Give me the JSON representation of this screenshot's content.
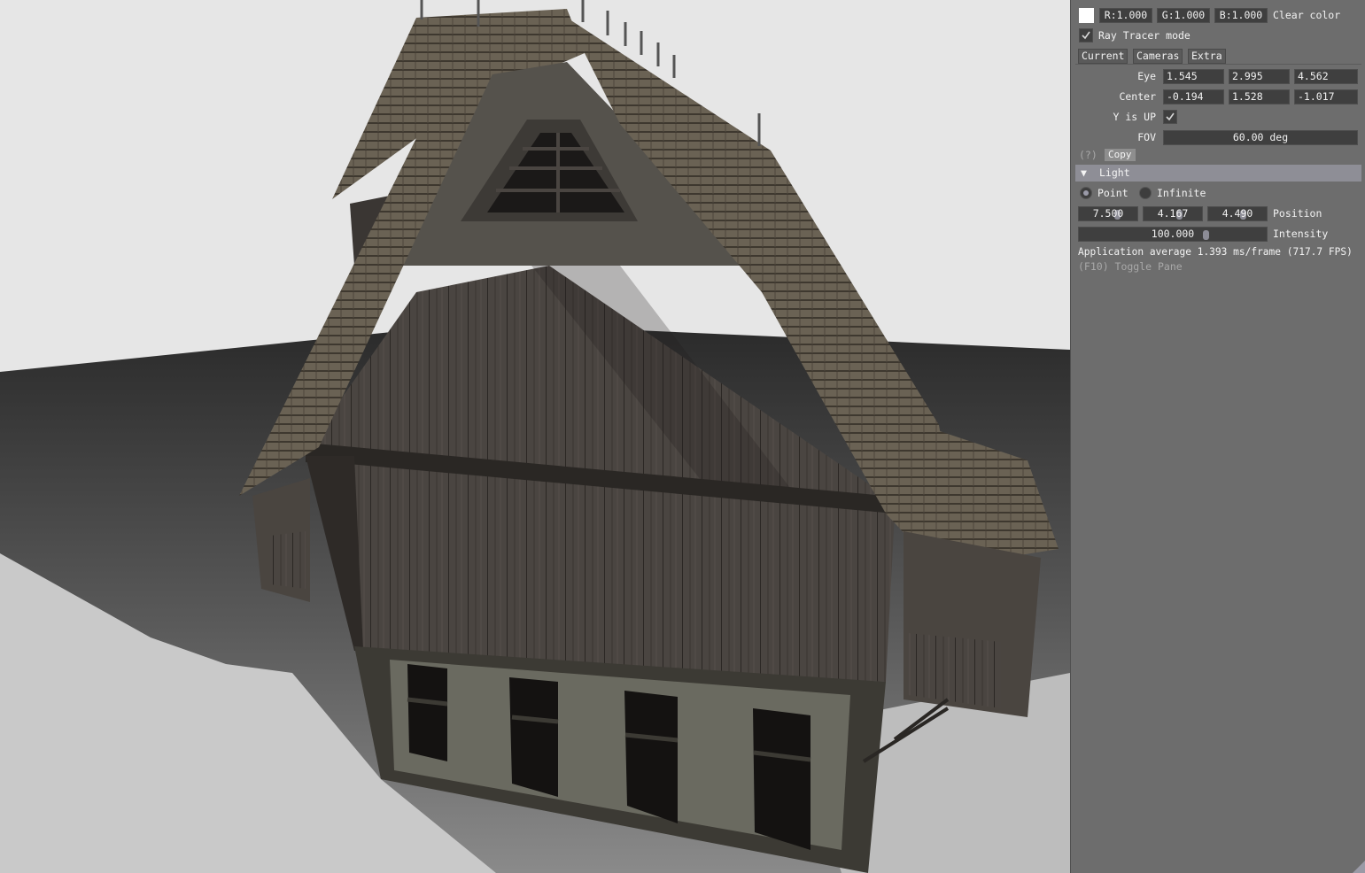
{
  "clear_color": {
    "swatch": "#ffffff",
    "r": "R:1.000",
    "g": "G:1.000",
    "b": "B:1.000",
    "label": "Clear color"
  },
  "ray_tracer": {
    "label": "Ray Tracer mode",
    "checked": true
  },
  "tabs": [
    {
      "label": "Current"
    },
    {
      "label": "Cameras"
    },
    {
      "label": "Extra"
    }
  ],
  "camera": {
    "eye": {
      "label": "Eye",
      "values": [
        "1.545",
        "2.995",
        "4.562"
      ]
    },
    "center": {
      "label": "Center",
      "values": [
        "-0.194",
        "1.528",
        "-1.017"
      ]
    },
    "y_up": {
      "label": "Y is UP",
      "checked": true
    },
    "fov": {
      "label": "FOV",
      "value": "60.00 deg"
    },
    "help": "(?)",
    "copy_label": "Copy"
  },
  "light": {
    "header": "Light",
    "collapse_icon": "triangle-down-icon",
    "modes": [
      {
        "label": "Point",
        "selected": true
      },
      {
        "label": "Infinite",
        "selected": false
      }
    ],
    "position": {
      "label": "Position",
      "values": [
        "7.500",
        "4.167",
        "4.490"
      ]
    },
    "intensity": {
      "label": "Intensity",
      "value": "100.000"
    }
  },
  "status": {
    "fps": "Application average 1.393 ms/frame (717.7 FPS)",
    "toggle_hint": "(F10) Toggle Pane"
  },
  "colors": {
    "pane_bg": "#6d6d6d",
    "field_bg": "#3f3f3f",
    "header_bg": "#8e8e96",
    "viewport_bg": "#e6e6e6"
  }
}
